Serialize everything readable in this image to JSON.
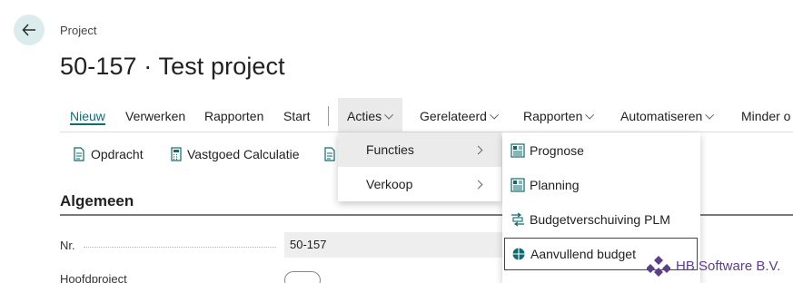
{
  "page": {
    "caption": "Project",
    "title": "50-157 · Test project"
  },
  "actionbar": {
    "items": [
      {
        "label": "Nieuw"
      },
      {
        "label": "Verwerken"
      },
      {
        "label": "Rapporten"
      },
      {
        "label": "Start"
      },
      {
        "label": "Acties"
      },
      {
        "label": "Gerelateerd"
      },
      {
        "label": "Rapporten"
      },
      {
        "label": "Automatiseren"
      },
      {
        "label": "Minder o"
      }
    ]
  },
  "subbar": {
    "items": [
      {
        "label": "Opdracht"
      },
      {
        "label": "Vastgoed Calculatie"
      }
    ]
  },
  "section": {
    "title": "Algemeen"
  },
  "fields": {
    "nr_label": "Nr.",
    "nr_value": "50-157",
    "second_label": "Hoofdproject"
  },
  "menu_acties": {
    "items": [
      {
        "label": "Functies"
      },
      {
        "label": "Verkoop"
      }
    ]
  },
  "menu_functies": {
    "items": [
      {
        "label": "Prognose"
      },
      {
        "label": "Planning"
      },
      {
        "label": "Budgetverschuiving PLM"
      },
      {
        "label": "Aanvullend budget"
      }
    ]
  },
  "watermark": {
    "text": "HB Software B.V."
  },
  "colors": {
    "accent": "#0f6b70",
    "back_button_bg": "#dcecec",
    "watermark": "#5b3e8c"
  }
}
